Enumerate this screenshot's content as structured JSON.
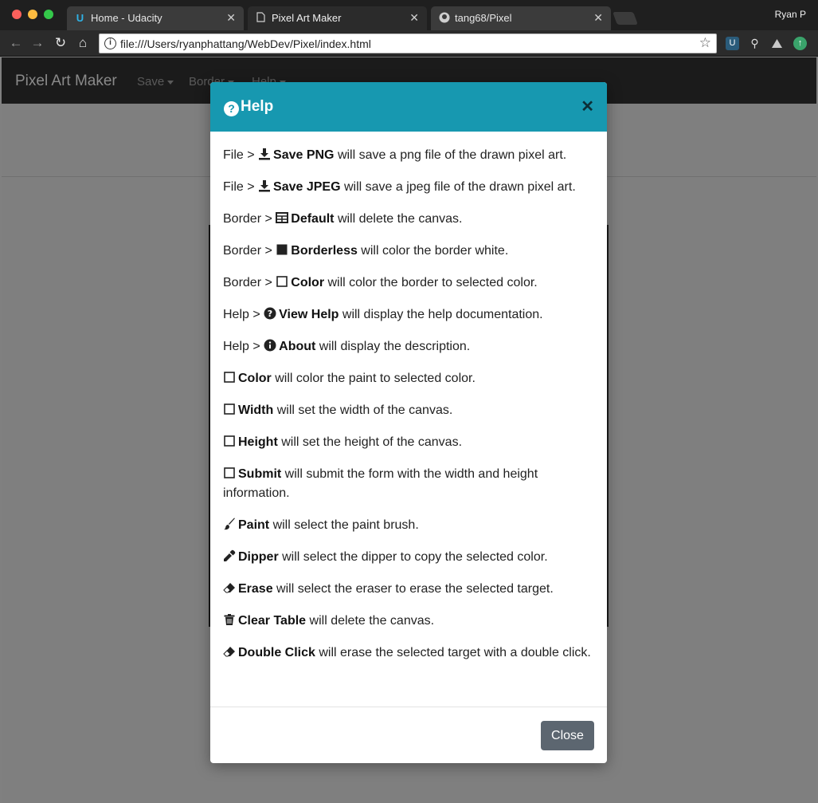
{
  "browser": {
    "tabs": [
      {
        "title": "Home - Udacity",
        "icon": "udacity-icon"
      },
      {
        "title": "Pixel Art Maker",
        "icon": "page-icon"
      },
      {
        "title": "tang68/Pixel",
        "icon": "github-icon"
      }
    ],
    "profile_name": "Ryan P",
    "url": "file:///Users/ryanphattang/WebDev/Pixel/index.html"
  },
  "app": {
    "brand": "Pixel Art Maker",
    "menu": [
      "Save",
      "Border",
      "Help"
    ]
  },
  "modal": {
    "title": "Help",
    "close_label": "Close",
    "header_color": "#1798b0",
    "lines": [
      {
        "prefix": "File > ",
        "icon": "download-icon",
        "label": "Save PNG",
        "text": " will save a png file of the drawn pixel art."
      },
      {
        "prefix": "File > ",
        "icon": "download-icon",
        "label": "Save JPEG",
        "text": " will save a jpeg file of the drawn pixel art."
      },
      {
        "prefix": "Border > ",
        "icon": "table-icon",
        "label": "Default",
        "text": " will delete the canvas."
      },
      {
        "prefix": "Border > ",
        "icon": "filled-square-icon",
        "label": "Borderless",
        "text": " will color the border white."
      },
      {
        "prefix": "Border > ",
        "icon": "empty-square-icon",
        "label": "Color",
        "text": " will color the border to selected color."
      },
      {
        "prefix": "Help > ",
        "icon": "question-circle-icon",
        "label": "View Help",
        "text": " will display the help documentation."
      },
      {
        "prefix": "Help > ",
        "icon": "info-circle-icon",
        "label": "About",
        "text": " will display the description."
      },
      {
        "prefix": "",
        "icon": "empty-square-icon",
        "label": "Color",
        "text": " will color the paint to selected color."
      },
      {
        "prefix": "",
        "icon": "empty-square-icon",
        "label": "Width",
        "text": " will set the width of the canvas."
      },
      {
        "prefix": "",
        "icon": "empty-square-icon",
        "label": "Height",
        "text": " will set the height of the canvas."
      },
      {
        "prefix": "",
        "icon": "empty-square-icon",
        "label": "Submit",
        "text": " will submit the form with the width and height information."
      },
      {
        "prefix": "",
        "icon": "paint-brush-icon",
        "label": "Paint",
        "text": " will select the paint brush."
      },
      {
        "prefix": "",
        "icon": "eyedropper-icon",
        "label": "Dipper",
        "text": " will select the dipper to copy the selected color."
      },
      {
        "prefix": "",
        "icon": "eraser-icon",
        "label": "Erase",
        "text": " will select the eraser to erase the selected target."
      },
      {
        "prefix": "",
        "icon": "trash-icon",
        "label": "Clear Table",
        "text": " will delete the canvas."
      },
      {
        "prefix": "",
        "icon": "eraser-icon",
        "label": "Double Click",
        "text": " will erase the selected target with a double click."
      }
    ]
  }
}
